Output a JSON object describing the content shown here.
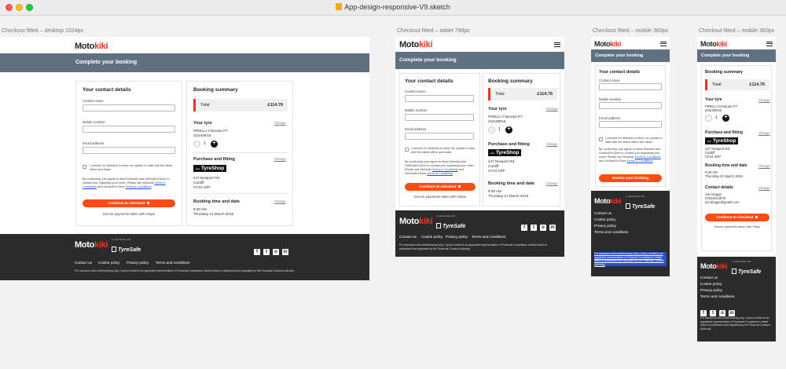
{
  "window": {
    "title": "App-design-responsive-V9.sketch"
  },
  "artboards": {
    "desktop": "Checkout fitted – desktop 1024px",
    "tablet": "Checkout fitted – tablet 768px",
    "mobile1": "Checkout fitted – mobile 360px",
    "mobile2": "Checkout fitted – mobile 360px"
  },
  "brand": {
    "logo_a": "Moto",
    "logo_b": "kiki",
    "accent": "#e8361f",
    "button": "#ff4d12",
    "band": "#5f7080",
    "footer": "#2b2b2b"
  },
  "page": {
    "heading": "Complete your booking"
  },
  "contact": {
    "heading": "Your contact details",
    "name_label": "Contact name",
    "mobile_label": "Mobile number",
    "email_label": "Email address",
    "consent": "I consent for Motokiki to keep me update to date with the latest offers and deals.",
    "terms_pre": "By continuing, you agree to allow Motokiki and GetAndGoTyres to contact you regarding your order. Please see Motokiki",
    "terms_link1": "Terms & Conditions",
    "terms_mid": "and GetAndGoTyres",
    "terms_link2": "Terms & Conditions",
    "checkout_button": "Continue to checkout",
    "review_button": "Review your booking",
    "secure": "Secure payments taken with Stripe"
  },
  "summary": {
    "heading": "Booking summary",
    "total_label": "Total",
    "total_value": "£114.76",
    "change": "Change",
    "tyre_heading": "Your tyre",
    "tyre_name": "PIRELLI Cinturato P7",
    "tyre_size": "215/45R16",
    "quantity": "1",
    "fitting_heading": "Purchase and fitting",
    "fitter_by": "Get",
    "fitter_logo": "TyreShop",
    "address1": "447 Newport Rd",
    "address2": "Cardiff",
    "address3": "CF24 1RP",
    "time_heading": "Booking time and date",
    "time": "9:30 AM",
    "date": "Thursday 21 March 2019",
    "contact_heading": "Contact details",
    "contact_name": "Joe bloggs",
    "contact_phone": "07911913075",
    "contact_email": "joe.bloggs@gmail.com"
  },
  "footer": {
    "partner_small": "in partnership with",
    "partner_name": "TyreSafe",
    "links": [
      "Contact us",
      "Cookie policy",
      "Privacy policy",
      "Terms and conditions"
    ],
    "legal": "For insurance and credit broking only, Cyclus Limited is an appointed representative of Financial Compliance Limited which is authorised and regulated by the Financial Conduct Authority.",
    "social_icons": [
      "facebook-icon",
      "twitter-icon",
      "instagram-icon",
      "linkedin-icon"
    ]
  }
}
